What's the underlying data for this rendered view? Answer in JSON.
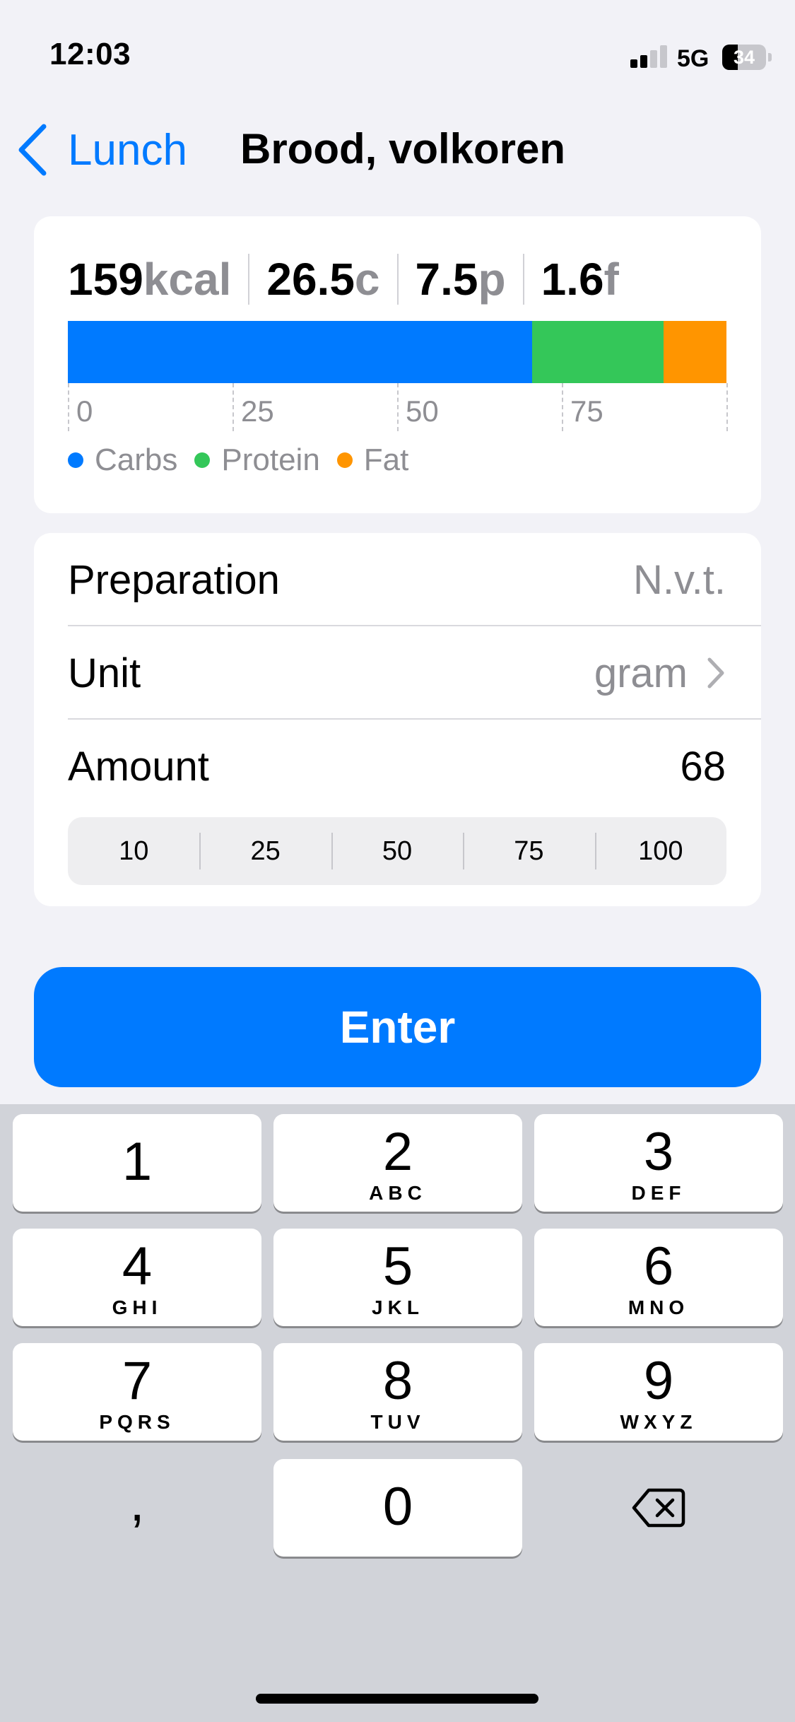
{
  "status_bar": {
    "time": "12:03",
    "network": "5G",
    "battery": "34"
  },
  "nav": {
    "back_label": "Lunch",
    "title": "Brood, volkoren"
  },
  "macros": {
    "kcal": "159",
    "kcal_unit": "kcal",
    "carbs": "26.5",
    "carbs_unit": "c",
    "protein": "7.5",
    "protein_unit": "p",
    "fat": "1.6",
    "fat_unit": "f"
  },
  "chart_data": {
    "type": "bar",
    "orientation": "horizontal-stacked",
    "categories": [
      "Carbs",
      "Protein",
      "Fat"
    ],
    "values": [
      70.5,
      20,
      9.5
    ],
    "ticks": [
      "0",
      "25",
      "50",
      "75"
    ],
    "xlim": [
      0,
      100
    ],
    "colors": {
      "Carbs": "#007aff",
      "Protein": "#34c759",
      "Fat": "#ff9500"
    },
    "legend": [
      "Carbs",
      "Protein",
      "Fat"
    ],
    "legend_position": "bottom-left",
    "grid": true
  },
  "form": {
    "preparation_label": "Preparation",
    "preparation_value": "N.v.t.",
    "unit_label": "Unit",
    "unit_value": "gram",
    "amount_label": "Amount",
    "amount_value": "68",
    "quick_amounts": [
      "10",
      "25",
      "50",
      "75",
      "100"
    ]
  },
  "enter_label": "Enter",
  "keypad": {
    "keys": [
      {
        "num": "1",
        "letters": ""
      },
      {
        "num": "2",
        "letters": "ABC"
      },
      {
        "num": "3",
        "letters": "DEF"
      },
      {
        "num": "4",
        "letters": "GHI"
      },
      {
        "num": "5",
        "letters": "JKL"
      },
      {
        "num": "6",
        "letters": "MNO"
      },
      {
        "num": "7",
        "letters": "PQRS"
      },
      {
        "num": "8",
        "letters": "TUV"
      },
      {
        "num": "9",
        "letters": "WXYZ"
      }
    ],
    "comma": ",",
    "zero": "0"
  },
  "colors": {
    "accent": "#007aff",
    "carbs": "#007aff",
    "protein": "#34c759",
    "fat": "#ff9500"
  }
}
